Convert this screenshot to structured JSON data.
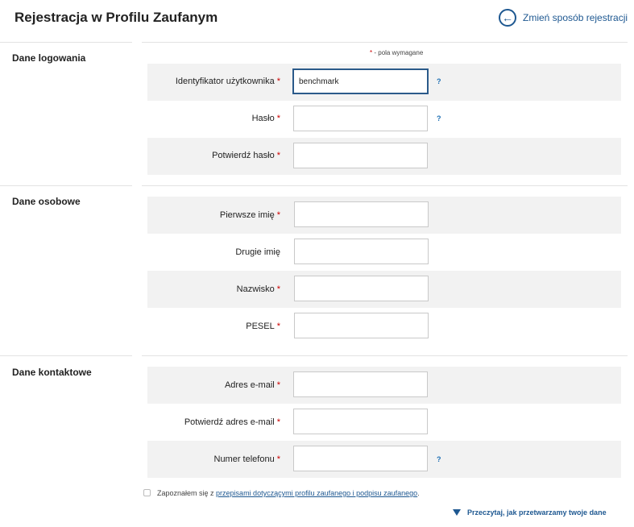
{
  "header": {
    "title": "Rejestracja w Profilu Zaufanym",
    "change_method": "Zmień sposób rejestracji"
  },
  "required_note": {
    "star": "*",
    "text": "- pola wymagane"
  },
  "sections": {
    "login": {
      "title": "Dane logowania",
      "fields": [
        {
          "label": "Identyfikator użytkownika",
          "required": "*",
          "value": "benchmark",
          "help": "?"
        },
        {
          "label": "Hasło",
          "required": "*",
          "value": "",
          "help": "?"
        },
        {
          "label": "Potwierdź hasło",
          "required": "*",
          "value": ""
        }
      ]
    },
    "personal": {
      "title": "Dane osobowe",
      "fields": [
        {
          "label": "Pierwsze imię",
          "required": "*",
          "value": ""
        },
        {
          "label": "Drugie imię",
          "value": ""
        },
        {
          "label": "Nazwisko",
          "required": "*",
          "value": ""
        },
        {
          "label": "PESEL",
          "required": "*",
          "value": ""
        }
      ]
    },
    "contact": {
      "title": "Dane kontaktowe",
      "fields": [
        {
          "label": "Adres e-mail",
          "required": "*",
          "value": ""
        },
        {
          "label": "Potwierdź adres e-mail",
          "required": "*",
          "value": ""
        },
        {
          "label": "Numer telefonu",
          "required": "*",
          "value": "",
          "help": "?"
        }
      ]
    }
  },
  "agreement": {
    "text_before": "Zapoznałem się z ",
    "link_text": "przepisami dotyczącymi profilu zaufanego i podpisu zaufanego",
    "text_after": ".",
    "checked": false
  },
  "gdpr_link": "Przeczytaj, jak przetwarzamy twoje dane",
  "colors": {
    "accent": "#1e5891",
    "required_star": "#cc0000",
    "row_shade": "#f2f2f2"
  }
}
